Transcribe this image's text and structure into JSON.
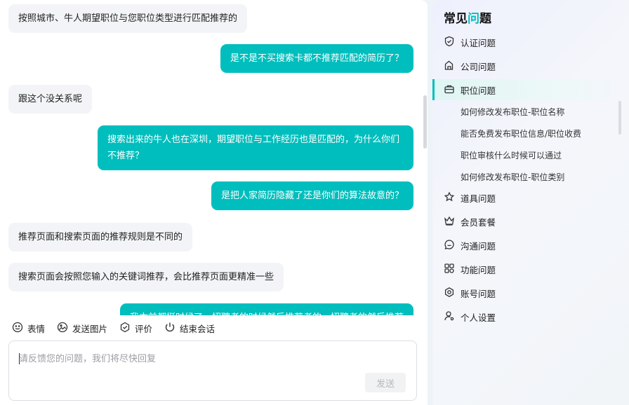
{
  "messages": [
    {
      "side": "in",
      "text": "按照城市、牛人期望职位与您职位类型进行匹配推荐的"
    },
    {
      "side": "out",
      "text": "是不是不买搜索卡都不推荐匹配的简历了？"
    },
    {
      "side": "in",
      "text": "跟这个没关系呢"
    },
    {
      "side": "out",
      "text": "搜索出来的牛人也在深圳，期望职位与工作经历也是匹配的，为什么你们不推荐？"
    },
    {
      "side": "out",
      "text": "是把人家简历隐藏了还是你们的算法故意的？"
    },
    {
      "side": "in",
      "text": "推荐页面和搜索页面的推荐规则是不同的"
    },
    {
      "side": "in",
      "text": "搜索页面会按照您输入的关键词推荐，会比推荐页面更精准一些"
    },
    {
      "side": "out",
      "text": "我本前都挺时候了，招聘者的时候然后推荐者的，招聘者的然后推荐"
    }
  ],
  "toolbar": {
    "emoji_label": "表情",
    "image_label": "发送图片",
    "rate_label": "评价",
    "end_label": "结束会话"
  },
  "input": {
    "placeholder": "请反馈您的问题，我们将尽快回复",
    "value": "",
    "send_label": "发送"
  },
  "faq": {
    "title_main": "常见",
    "title_accent": "问",
    "title_tail": "题",
    "items": [
      {
        "label": "认证问题",
        "icon": "shield-check-icon"
      },
      {
        "label": "公司问题",
        "icon": "building-icon"
      },
      {
        "label": "职位问题",
        "icon": "briefcase-icon",
        "active": true
      },
      {
        "label": "道具问题",
        "icon": "star-icon"
      },
      {
        "label": "会员套餐",
        "icon": "crown-icon"
      },
      {
        "label": "沟通问题",
        "icon": "chat-bubble-icon"
      },
      {
        "label": "功能问题",
        "icon": "grid-icon"
      },
      {
        "label": "账号问题",
        "icon": "gear-icon"
      },
      {
        "label": "个人设置",
        "icon": "user-settings-icon"
      }
    ],
    "sub_items": [
      "如何修改发布职位-职位名称",
      "能否免费发布职位信息/职位收费",
      "职位审核什么时候可以通过",
      "如何修改发布职位-职位类别"
    ]
  },
  "colors": {
    "accent": "#00bebd",
    "incoming_bubble": "#f3f4f7"
  }
}
